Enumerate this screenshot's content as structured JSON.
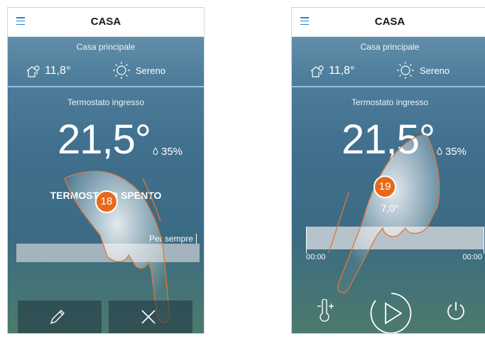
{
  "screens": [
    {
      "header": {
        "title": "CASA"
      },
      "home_name": "Casa principale",
      "outside_temp": "11,8°",
      "weather": "Sereno",
      "thermostat_name": "Termostato ingresso",
      "temperature": "21,5°",
      "humidity": "35%",
      "status": "TERMOSTATO SPENTO",
      "duration_label": "Per sempre",
      "step_number": "18",
      "buttons": {
        "edit": "edit-icon",
        "close": "close-icon"
      }
    },
    {
      "header": {
        "title": "CASA"
      },
      "home_name": "Casa principale",
      "outside_temp": "11,8°",
      "weather": "Sereno",
      "thermostat_name": "Termostato ingresso",
      "temperature": "21,5°",
      "humidity": "35%",
      "setpoint": "7,0°",
      "timeline": {
        "start": "00:00",
        "end": "00:00"
      },
      "step_number": "19",
      "buttons": {
        "boost": "thermometer-plus-icon",
        "play": "play-icon",
        "power": "power-icon"
      }
    }
  ]
}
